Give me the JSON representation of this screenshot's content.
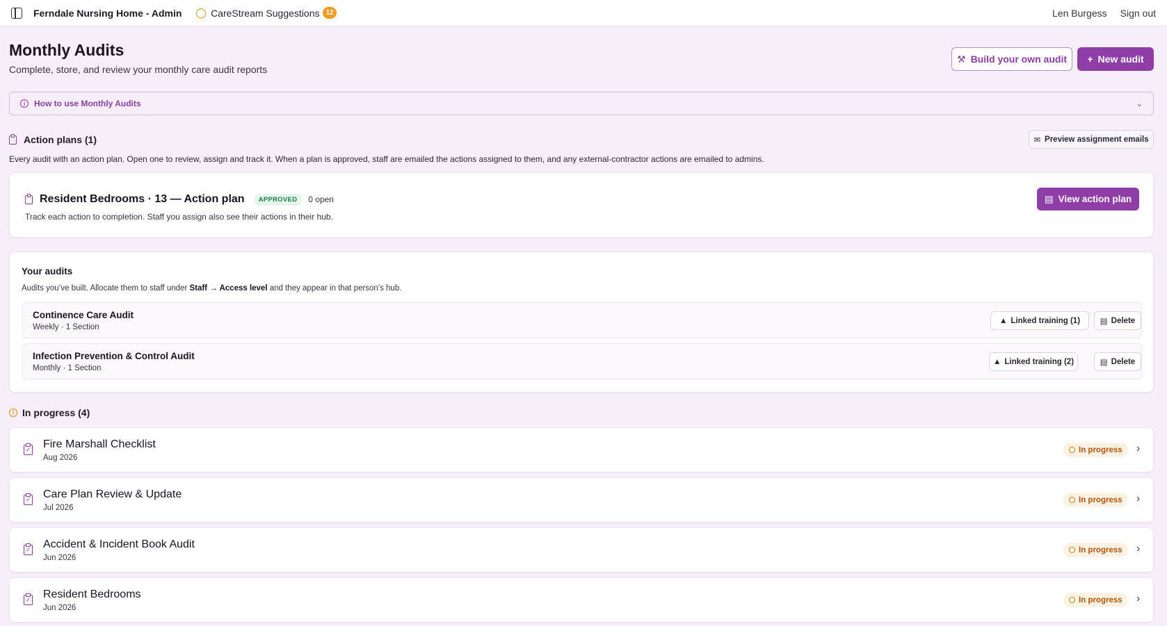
{
  "topbar": {
    "app_name": "Ferndale Nursing Home - Admin",
    "suggestions_label": "CareStream Suggestions",
    "suggestions_count": "12",
    "user_name": "Len Burgess",
    "sign_out": "Sign out"
  },
  "header": {
    "title": "Monthly Audits",
    "subtitle": "Complete, store, and review your monthly care audit reports",
    "build_label": "Build your own audit",
    "new_label": "New audit"
  },
  "howto": {
    "label": "How to use Monthly Audits"
  },
  "action_plans": {
    "heading": "Action plans (1)",
    "preview_label": "Preview assignment emails",
    "description": "Every audit with an action plan. Open one to review, assign and track it. When a plan is approved, staff are emailed the actions assigned to them, and any external-contractor actions are emailed to admins.",
    "plan": {
      "title": "Resident Bedrooms · 13 — Action plan",
      "status": "APPROVED",
      "open": "0 open",
      "description": "Track each action to completion. Staff you assign also see their actions in their hub.",
      "view_label": "View action plan"
    }
  },
  "your_audits": {
    "title": "Your audits",
    "desc_prefix": "Audits you’ve built. Allocate them to staff under ",
    "desc_bold1": "Staff",
    "desc_arrow": " → ",
    "desc_bold2": "Access level",
    "desc_suffix": " and they appear in that person’s hub.",
    "items": [
      {
        "name": "Continence Care Audit",
        "meta": "Weekly · 1 Section",
        "training": "Linked training (1)",
        "delete": "Delete"
      },
      {
        "name": "Infection Prevention & Control Audit",
        "meta": "Monthly · 1 Section",
        "training": "Linked training (2)",
        "delete": "Delete"
      }
    ]
  },
  "in_progress": {
    "heading": "In progress (4)",
    "items": [
      {
        "title": "Fire Marshall Checklist",
        "date": "Aug 2026",
        "status": "In progress"
      },
      {
        "title": "Care Plan Review & Update",
        "date": "Jul 2026",
        "status": "In progress"
      },
      {
        "title": "Accident & Incident Book Audit",
        "date": "Jun 2026",
        "status": "In progress"
      },
      {
        "title": "Resident Bedrooms",
        "date": "Jun 2026",
        "status": "In progress"
      }
    ]
  },
  "colors": {
    "accent": "#8e3ea6",
    "background": "#f4eff8",
    "warning": "#e58a1a",
    "success": "#15803d"
  }
}
